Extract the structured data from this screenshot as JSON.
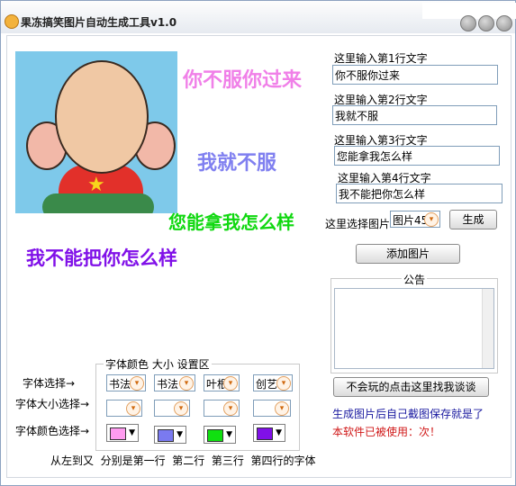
{
  "window": {
    "title": "果冻搞笑图片自动生成工具v1.0"
  },
  "preview": {
    "line1": {
      "text": "你不服你过来",
      "color": "#f080e8"
    },
    "line2": {
      "text": "我就不服",
      "color": "#8080f0"
    },
    "line3": {
      "text": "您能拿我怎么样",
      "color": "#10d810"
    },
    "line4": {
      "text": "我不能把你怎么样",
      "color": "#8010e8"
    }
  },
  "inputs": [
    {
      "label": "这里输入第1行文字",
      "value": "你不服你过来"
    },
    {
      "label": "这里输入第2行文字",
      "value": "我就不服"
    },
    {
      "label": "这里输入第3行文字",
      "value": "您能拿我怎么样"
    },
    {
      "label": "这里输入第4行文字",
      "value": "我不能把你怎么样"
    }
  ],
  "picture_select": {
    "label": "这里选择图片",
    "value": "图片45"
  },
  "buttons": {
    "generate": "生成",
    "add_image": "添加图片",
    "contact": "不会玩的点击这里找我谈谈"
  },
  "notice": {
    "title": "公告"
  },
  "footer": {
    "tip": "生成图片后自己截图保存就是了",
    "usage": "本软件已被使用：次！"
  },
  "settings": {
    "group_title": "字体颜色 大小 设置区",
    "row_labels": {
      "font": "字体选择→",
      "size": "字体大小选择→",
      "color": "字体颜色选择→"
    },
    "fonts": [
      "书法",
      "书法",
      "叶根",
      "创艺"
    ],
    "colors": [
      "#ff9cf0",
      "#7a7af0",
      "#10e010",
      "#8010e8"
    ],
    "caption": "从左到又  分别是第一行  第二行  第三行  第四行的字体"
  }
}
